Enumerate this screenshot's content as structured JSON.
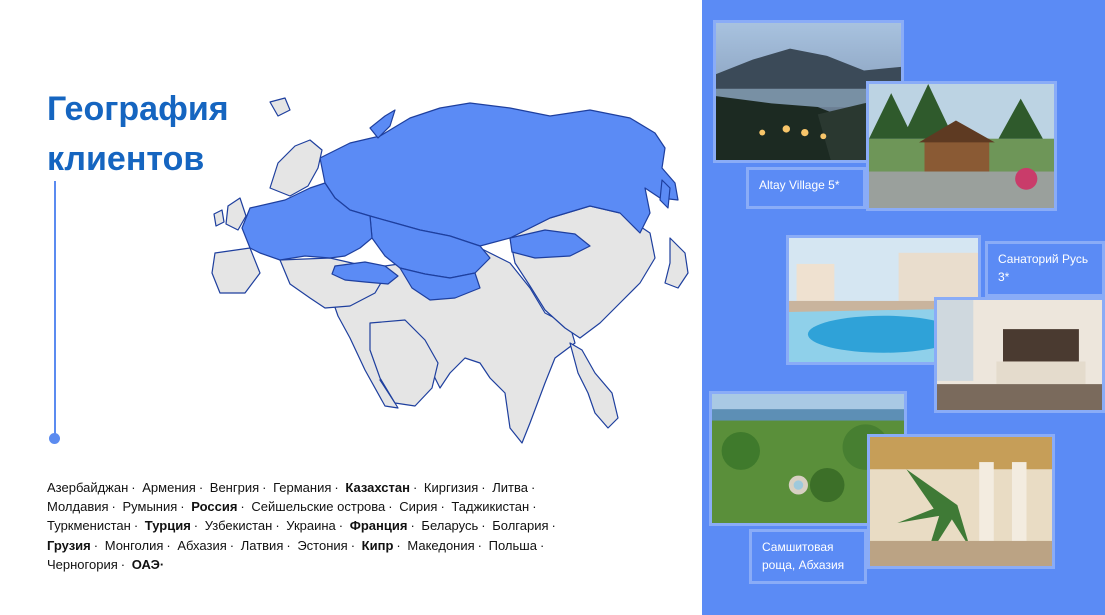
{
  "title": {
    "line1": "География",
    "line2": "клиентов"
  },
  "countries": [
    {
      "name": "Азербайджан",
      "bold": false
    },
    {
      "name": "Армения",
      "bold": false
    },
    {
      "name": "Венгрия",
      "bold": false
    },
    {
      "name": "Германия",
      "bold": false
    },
    {
      "name": "Казахстан",
      "bold": true
    },
    {
      "name": "Киргизия",
      "bold": false
    },
    {
      "name": "Литва",
      "bold": false
    },
    {
      "name": "Молдавия",
      "bold": false
    },
    {
      "name": "Румыния",
      "bold": false
    },
    {
      "name": "Россия",
      "bold": true
    },
    {
      "name": "Сейшельские острова",
      "bold": false
    },
    {
      "name": "Сирия",
      "bold": false
    },
    {
      "name": "Таджикистан",
      "bold": false
    },
    {
      "name": "Туркменистан",
      "bold": false
    },
    {
      "name": "Турция",
      "bold": true
    },
    {
      "name": "Узбекистан",
      "bold": false
    },
    {
      "name": "Украина",
      "bold": false
    },
    {
      "name": "Франция",
      "bold": true
    },
    {
      "name": "Беларусь",
      "bold": false
    },
    {
      "name": "Болгария",
      "bold": false
    },
    {
      "name": "Грузия",
      "bold": true
    },
    {
      "name": "Монголия",
      "bold": false
    },
    {
      "name": "Абхазия",
      "bold": false
    },
    {
      "name": "Латвия",
      "bold": false
    },
    {
      "name": "Эстония",
      "bold": false
    },
    {
      "name": "Кипр",
      "bold": true
    },
    {
      "name": "Македония",
      "bold": false
    },
    {
      "name": "Польша",
      "bold": false
    },
    {
      "name": "Черногория",
      "bold": false
    },
    {
      "name": "ОАЭ·",
      "bold": true
    }
  ],
  "hotels": {
    "altay": "Altay Village 5*",
    "rus": "Санаторий Русь 3*",
    "samshit": "Самшитовая роща, Абхазия"
  },
  "colors": {
    "accent": "#1565c0",
    "highlight_country": "#5b8bf5",
    "other_country": "#e5e5e5",
    "panel": "#5b8bf5"
  }
}
